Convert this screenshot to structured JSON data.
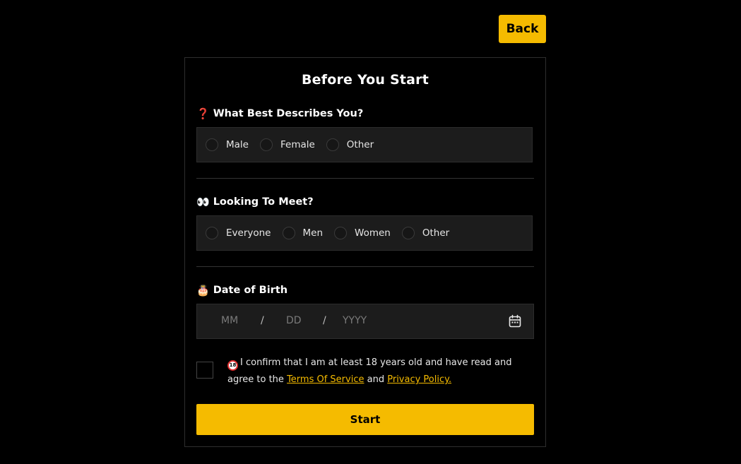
{
  "header": {
    "back_label": "Back"
  },
  "form": {
    "title": "Before You Start",
    "gender_section": {
      "icon": "question-mark-icon",
      "emoji": "❓",
      "label": "What Best Describes You?",
      "options": [
        "Male",
        "Female",
        "Other"
      ]
    },
    "meet_section": {
      "icon": "eyes-icon",
      "emoji": "👀",
      "label": "Looking To Meet?",
      "options": [
        "Everyone",
        "Men",
        "Women",
        "Other"
      ]
    },
    "dob_section": {
      "icon": "birthday-cake-icon",
      "emoji": "🎂",
      "label": "Date of Birth",
      "month_placeholder": "MM",
      "day_placeholder": "DD",
      "year_placeholder": "YYYY",
      "separator": "/"
    },
    "confirm": {
      "icon": "no-under-18-icon",
      "text_before": "I confirm that I am at least 18 years old and have read and agree to the",
      "terms_link": "Terms Of Service",
      "and_text": "and",
      "privacy_link": "Privacy Policy."
    },
    "start_label": "Start"
  },
  "colors": {
    "accent": "#f5bb00",
    "background": "#000000",
    "field_bg": "#1c1c1c"
  }
}
